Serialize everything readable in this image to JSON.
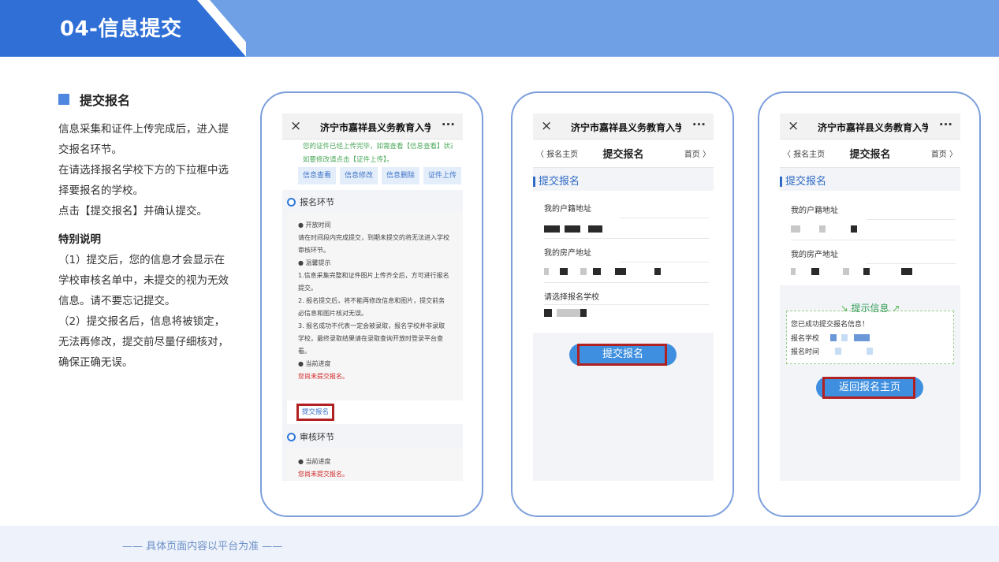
{
  "header": {
    "title": "04-信息提交"
  },
  "section": {
    "title": "提交报名"
  },
  "intro_lines": [
    "信息采集和证件上传完成后，进入提",
    "交报名环节。",
    "在请选择报名学校下方的下拉框中选",
    "择要报名的学校。",
    "点击【提交报名】并确认提交。"
  ],
  "special": {
    "title": "特别说明",
    "lines": [
      "（1）提交后，您的信息才会显示在",
      "学校审核名单中，未提交的视为无效",
      "信息。请不要忘记提交。",
      "（2）提交报名后，信息将被锁定，",
      "无法再修改，提交前尽量仔细核对，",
      "确保正确无误。"
    ]
  },
  "footer": {
    "note": "—— 具体页面内容以平台为准 ——"
  },
  "phone_common": {
    "close": "×",
    "title": "济宁市嘉祥县义务教育入学",
    "more": "···"
  },
  "phone1": {
    "green_line1": "您的证件已经上传完毕，如需查看【信息查看】状态操作，",
    "green_line2": "如要修改请点击【证件上传】。",
    "chips": [
      "信息查看",
      "信息修改",
      "信息删除",
      "证件上传"
    ],
    "step1": "报名环节",
    "body": [
      "● 开放时间",
      "请在时间段内完成提交，到期未提交的将无法进入学校",
      "审核环节。",
      "● 温馨提示",
      "1.信息采集完整和证件图片上传齐全后，方可进行报名",
      "提交。",
      "2. 报名提交后，将不能再修改信息和图片，提交前务",
      "必信息和图片核对无误。",
      "3. 报名成功不代表一定会被录取，报名学校并非录取",
      "学校，最终录取结果请在录取查询开放时登录平台查",
      "看。",
      "● 当前进度"
    ],
    "status": "您尚未提交报名。",
    "submit_link": "提交报名",
    "step2": "审核环节",
    "progress_label": "● 当前进度",
    "status2": "您尚未提交报名。"
  },
  "phone2": {
    "back": "〈 报名主页",
    "title": "提交报名",
    "home": "首页 〉",
    "section": "提交报名",
    "field1": "我的户籍地址",
    "field2": "我的房产地址",
    "field3": "请选择报名学校",
    "button": "提交报名"
  },
  "phone3": {
    "back": "〈 报名主页",
    "title": "提交报名",
    "home": "首页 〉",
    "section": "提交报名",
    "field1": "我的户籍地址",
    "field2": "我的房产地址",
    "info_title": "提示信息",
    "info_line1": "您已成功提交报名信息！",
    "info_line2": "报名学校",
    "info_line3": "报名时间",
    "button": "返回报名主页"
  },
  "colors": {
    "header_band": "#6fa0e6",
    "header_tab": "#2f6fd6",
    "accent_blue": "#4f86e0",
    "highlight_red": "#b12121",
    "button_blue": "#3f8fe0"
  }
}
